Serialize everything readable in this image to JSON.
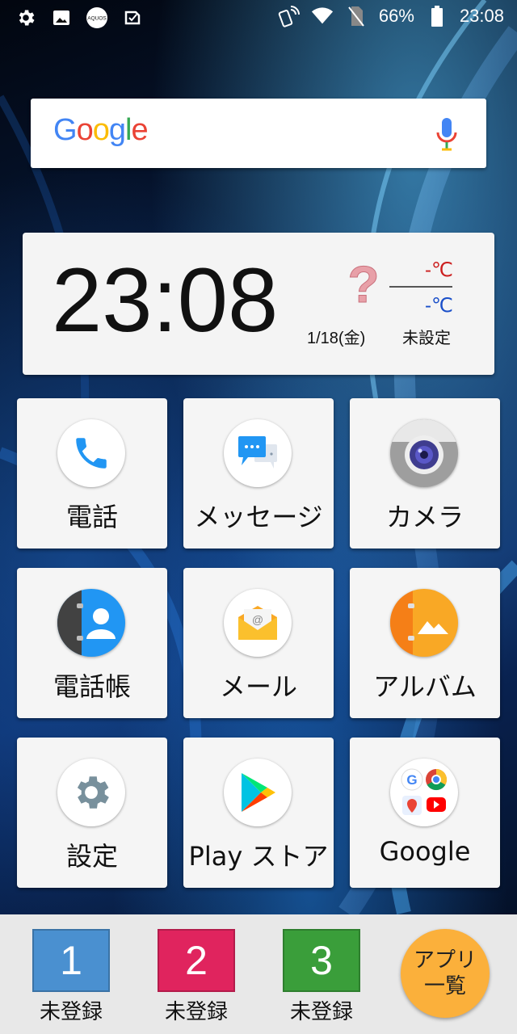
{
  "status_bar": {
    "battery": "66%",
    "time": "23:08",
    "left_icons": [
      "gear-icon",
      "image-icon",
      "aquos-icon",
      "screenshot-icon"
    ],
    "right_icons": [
      "nfc-phone-icon",
      "wifi-icon",
      "no-sim-icon",
      "battery-icon"
    ],
    "aquos_badge": "AQUOS"
  },
  "search": {
    "logo": "Google",
    "logo_colors": [
      "#4285F4",
      "#EA4335",
      "#FBBC05",
      "#4285F4",
      "#34A853",
      "#EA4335"
    ]
  },
  "clock_widget": {
    "time": "23:08",
    "weather_symbol": "?",
    "temp_high": "-℃",
    "temp_low": "-℃",
    "date": "1/18(金)",
    "weather_status": "未設定"
  },
  "apps": [
    {
      "label": "電話",
      "icon": "phone-icon"
    },
    {
      "label": "メッセージ",
      "icon": "message-icon"
    },
    {
      "label": "カメラ",
      "icon": "camera-icon"
    },
    {
      "label": "電話帳",
      "icon": "contacts-icon"
    },
    {
      "label": "メール",
      "icon": "mail-icon"
    },
    {
      "label": "アルバム",
      "icon": "album-icon"
    },
    {
      "label": "設定",
      "icon": "settings-icon"
    },
    {
      "label": "Play ストア",
      "icon": "play-store-icon"
    },
    {
      "label": "Google",
      "icon": "google-folder-icon"
    }
  ],
  "dock": {
    "shortcuts": [
      {
        "number": "1",
        "label": "未登録",
        "color": "#4a90d0"
      },
      {
        "number": "2",
        "label": "未登録",
        "color": "#e0245e"
      },
      {
        "number": "3",
        "label": "未登録",
        "color": "#3a9e3a"
      }
    ],
    "all_apps_line1": "アプリ",
    "all_apps_line2": "一覧"
  }
}
